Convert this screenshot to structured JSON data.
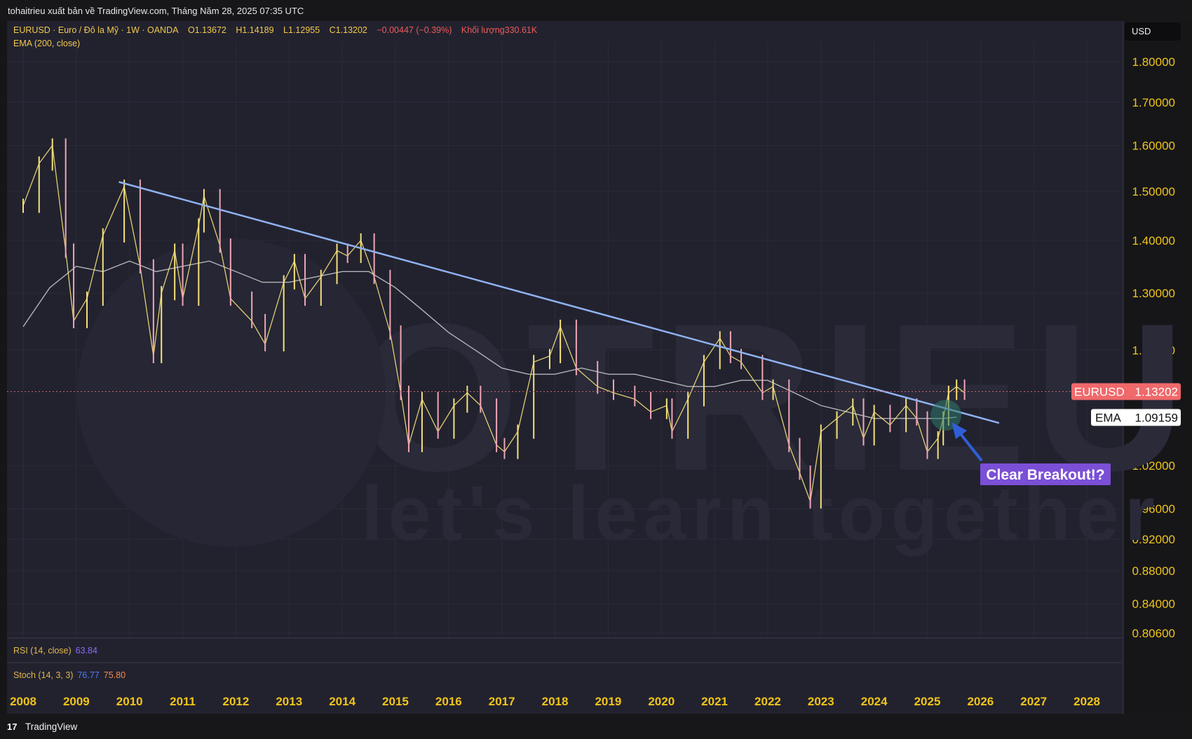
{
  "publisher_line": "tohaitrieu xuất bản về TradingView.com, Tháng Năm 28, 2025 07:35 UTC",
  "legend": {
    "symbol": "EURUSD · Euro / Đô la Mỹ · 1W · OANDA",
    "open": "O1.13672",
    "high": "H1.14189",
    "low": "L1.12955",
    "close": "C1.13202",
    "change": "−0.00447 (−0.39%)",
    "volume": "Khối lượng330.61K",
    "ema_label": "EMA (200, close)"
  },
  "currency_label": "USD",
  "indicators": {
    "rsi_label": "RSI (14, close)",
    "rsi_value": "63.84",
    "stoch_label": "Stoch (14, 3, 3)",
    "stoch_k": "76.77",
    "stoch_d": "75.80"
  },
  "price_tag": {
    "name": "EURUSD",
    "value": "1.13202"
  },
  "ema_tag": {
    "name": "EMA",
    "value": "1.09159"
  },
  "annotation": "Clear Breakout!?",
  "watermark": {
    "brand": "TOTRIEU",
    "slogan": "let's learn together"
  },
  "footer_brand": "TradingView",
  "colors": {
    "background": "#22222f",
    "price_line": "#f5e27a",
    "ema_line": "#b3b3b8",
    "trendline": "#8fb2f0",
    "axis_text": "#f0c419",
    "annotation_bg": "#7b4fd6",
    "price_tag_bg": "#f0696b",
    "arrow": "#2f5fd8"
  },
  "chart_data": {
    "type": "line",
    "title": "",
    "xlabel": "",
    "ylabel": "",
    "x_ticks": [
      "2008",
      "2009",
      "2010",
      "2011",
      "2012",
      "2013",
      "2014",
      "2015",
      "2016",
      "2017",
      "2018",
      "2019",
      "2020",
      "2021",
      "2022",
      "2023",
      "2024",
      "2025",
      "2026",
      "2027",
      "2028"
    ],
    "y_ticks": [
      "1.80000",
      "1.70000",
      "1.60000",
      "1.50000",
      "1.40000",
      "1.30000",
      "1.20000",
      "1.02000",
      "0.96000",
      "0.92000",
      "0.88000",
      "0.84000",
      "0.80600"
    ],
    "ylim": [
      0.806,
      1.8
    ],
    "price_scale": "log",
    "grid": true,
    "series": [
      {
        "name": "EURUSD",
        "x": [
          2008.0,
          2008.3,
          2008.55,
          2008.8,
          2008.95,
          2009.2,
          2009.5,
          2009.9,
          2010.2,
          2010.45,
          2010.6,
          2010.85,
          2011.0,
          2011.3,
          2011.4,
          2011.7,
          2011.9,
          2012.3,
          2012.55,
          2012.9,
          2013.1,
          2013.3,
          2013.6,
          2013.9,
          2014.1,
          2014.35,
          2014.6,
          2014.9,
          2015.1,
          2015.25,
          2015.5,
          2015.8,
          2016.1,
          2016.35,
          2016.6,
          2016.9,
          2017.05,
          2017.3,
          2017.6,
          2017.9,
          2018.1,
          2018.4,
          2018.8,
          2019.1,
          2019.5,
          2019.8,
          2020.1,
          2020.2,
          2020.5,
          2020.8,
          2021.1,
          2021.3,
          2021.5,
          2021.9,
          2022.1,
          2022.4,
          2022.6,
          2022.8,
          2023.0,
          2023.3,
          2023.6,
          2023.8,
          2024.0,
          2024.3,
          2024.6,
          2024.8,
          2025.0,
          2025.2,
          2025.3,
          2025.4,
          2025.55,
          2025.7
        ],
        "values": [
          1.47,
          1.56,
          1.6,
          1.38,
          1.25,
          1.29,
          1.41,
          1.51,
          1.35,
          1.19,
          1.3,
          1.38,
          1.29,
          1.43,
          1.49,
          1.39,
          1.29,
          1.25,
          1.21,
          1.32,
          1.36,
          1.29,
          1.33,
          1.38,
          1.37,
          1.4,
          1.33,
          1.23,
          1.13,
          1.05,
          1.12,
          1.07,
          1.11,
          1.13,
          1.11,
          1.05,
          1.04,
          1.07,
          1.18,
          1.19,
          1.24,
          1.17,
          1.14,
          1.13,
          1.12,
          1.1,
          1.11,
          1.07,
          1.12,
          1.18,
          1.22,
          1.19,
          1.18,
          1.13,
          1.14,
          1.05,
          1.01,
          0.97,
          1.07,
          1.09,
          1.11,
          1.06,
          1.1,
          1.08,
          1.11,
          1.09,
          1.04,
          1.06,
          1.09,
          1.13,
          1.14,
          1.13
        ]
      },
      {
        "name": "EMA (200, close)",
        "x": [
          2008.0,
          2008.5,
          2009.0,
          2009.5,
          2010.0,
          2010.5,
          2011.0,
          2011.5,
          2012.0,
          2012.5,
          2013.0,
          2013.5,
          2014.0,
          2014.5,
          2015.0,
          2015.5,
          2016.0,
          2016.5,
          2017.0,
          2017.5,
          2018.0,
          2018.5,
          2019.0,
          2019.5,
          2020.0,
          2020.5,
          2021.0,
          2021.5,
          2022.0,
          2022.5,
          2023.0,
          2023.5,
          2024.0,
          2024.5,
          2025.0,
          2025.3,
          2025.55
        ],
        "values": [
          1.24,
          1.31,
          1.35,
          1.34,
          1.36,
          1.34,
          1.35,
          1.36,
          1.34,
          1.32,
          1.32,
          1.33,
          1.34,
          1.34,
          1.31,
          1.27,
          1.23,
          1.2,
          1.17,
          1.16,
          1.16,
          1.17,
          1.16,
          1.16,
          1.15,
          1.14,
          1.14,
          1.15,
          1.15,
          1.13,
          1.11,
          1.1,
          1.09,
          1.09,
          1.09,
          1.09,
          1.092
        ]
      }
    ],
    "trendline": {
      "x": [
        2009.8,
        2026.35
      ],
      "values": [
        1.52,
        1.083
      ]
    }
  }
}
